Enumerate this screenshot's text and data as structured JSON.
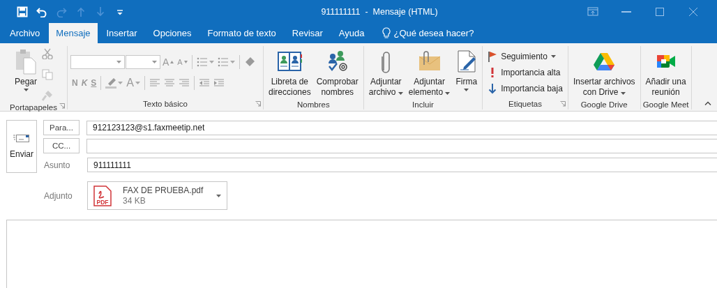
{
  "window": {
    "title": "911111111  -  Mensaje (HTML)"
  },
  "quick_access": [
    {
      "kind": "save",
      "disabled": false
    },
    {
      "kind": "undo",
      "disabled": false
    },
    {
      "kind": "redo",
      "disabled": true
    },
    {
      "kind": "up",
      "disabled": true
    },
    {
      "kind": "down",
      "disabled": true
    },
    {
      "kind": "customize",
      "disabled": false
    }
  ],
  "tabs": [
    {
      "label": "Archivo",
      "selected": false
    },
    {
      "label": "Mensaje",
      "selected": true
    },
    {
      "label": "Insertar",
      "selected": false
    },
    {
      "label": "Opciones",
      "selected": false
    },
    {
      "label": "Formato de texto",
      "selected": false
    },
    {
      "label": "Revisar",
      "selected": false
    },
    {
      "label": "Ayuda",
      "selected": false
    }
  ],
  "tell_me": {
    "placeholder": "¿Qué desea hacer?"
  },
  "ribbon": {
    "groups": [
      {
        "kind": "clipboard",
        "label": "Portapapeles",
        "dialog_launcher": true,
        "paste": {
          "label": "Pegar"
        }
      },
      {
        "kind": "basic_text",
        "label": "Texto básico",
        "dialog_launcher": true,
        "disabled": true,
        "grow": "A",
        "shrink": "A",
        "bold": "N",
        "italic": "K",
        "underline": "S",
        "font_color": "A"
      },
      {
        "kind": "buttons",
        "label": "Nombres",
        "dialog_launcher": false,
        "items": [
          {
            "kind": "large",
            "label": "Libreta de\ndirecciones",
            "dropdown": false
          },
          {
            "kind": "large",
            "label": "Comprobar\nnombres",
            "dropdown": false
          }
        ]
      },
      {
        "kind": "buttons",
        "label": "Incluir",
        "dialog_launcher": false,
        "items": [
          {
            "kind": "large",
            "label": "Adjuntar\narchivo",
            "dropdown": true
          },
          {
            "kind": "large",
            "label": "Adjuntar\nelemento",
            "dropdown": true
          },
          {
            "kind": "large",
            "label": "Firma",
            "dropdown": true
          }
        ]
      },
      {
        "kind": "buttons",
        "label": "Etiquetas",
        "dialog_launcher": true,
        "items": [
          {
            "kind": "small",
            "label": "Seguimiento",
            "dropdown": true
          },
          {
            "kind": "small",
            "label": "Importancia alta",
            "dropdown": false
          },
          {
            "kind": "small",
            "label": "Importancia baja",
            "dropdown": false
          }
        ]
      },
      {
        "kind": "buttons",
        "label": "Google Drive",
        "dialog_launcher": false,
        "items": [
          {
            "kind": "large",
            "label": "Insertar archivos\ncon Drive",
            "dropdown": true
          }
        ]
      },
      {
        "kind": "buttons",
        "label": "Google Meet",
        "dialog_launcher": false,
        "items": [
          {
            "kind": "large",
            "label": "Añadir una\nreunión",
            "dropdown": false
          }
        ]
      }
    ]
  },
  "compose": {
    "send": {
      "label": "Enviar"
    },
    "recipients": [
      {
        "button": "Para...",
        "value": "912123123@s1.faxmeetip.net"
      },
      {
        "button": "CC..."
      }
    ],
    "subject": {
      "label": "Asunto",
      "value": "911111111"
    },
    "attachments": {
      "label": "Adjunto",
      "items": [
        {
          "name": "FAX DE PRUEBA.pdf",
          "size": "34 KB",
          "type_label": "PDF"
        }
      ]
    }
  }
}
